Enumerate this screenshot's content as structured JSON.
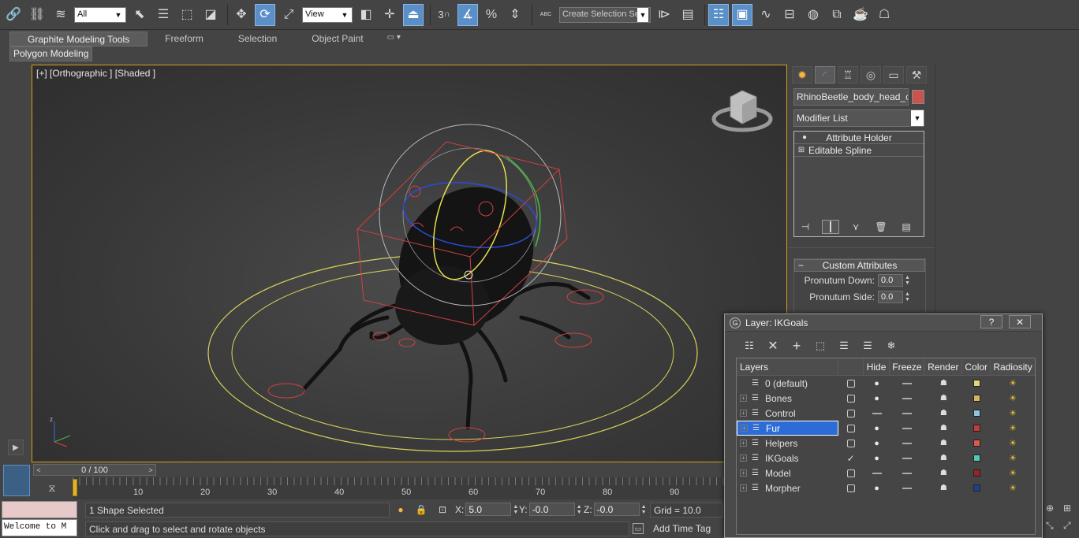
{
  "toolbar": {
    "filter_select": "All",
    "view_select": "View",
    "snap_label": "3",
    "selection_set_placeholder": "Create Selection Se",
    "abc_label": "ABC"
  },
  "ribbon": {
    "tabs": [
      "Graphite Modeling Tools",
      "Freeform",
      "Selection",
      "Object Paint"
    ],
    "panel_label": "Polygon Modeling"
  },
  "viewport": {
    "label": "[+] [Orthographic ] [Shaded ]",
    "axis_label_z": "z"
  },
  "command_panel": {
    "object_name": "RhinoBeetle_body_head_ctrl",
    "object_color": "#c8544d",
    "modifier_list": "Modifier List",
    "stack": [
      "Attribute Holder",
      "Editable Spline"
    ],
    "rollout_title": "Custom Attributes",
    "attributes": [
      {
        "label": "Pronutum Down:",
        "value": "0.0"
      },
      {
        "label": "Pronutum Side:",
        "value": "0.0"
      }
    ]
  },
  "layer_dialog": {
    "title": "Layer: IKGoals",
    "help_btn": "?",
    "close_btn": "✕",
    "columns": [
      "Layers",
      "Hide",
      "Freeze",
      "Render",
      "Color",
      "Radiosity"
    ],
    "rows": [
      {
        "name": "0 (default)",
        "expander": false,
        "active": false,
        "hide_style": "bulb",
        "freeze_style": "dash",
        "color": "#e3d67a",
        "selected": false
      },
      {
        "name": "Bones",
        "expander": true,
        "active": false,
        "hide_style": "bulb",
        "freeze_style": "dash",
        "color": "#d9b45a",
        "selected": false
      },
      {
        "name": "Control",
        "expander": true,
        "active": false,
        "hide_style": "dash",
        "freeze_style": "dash",
        "color": "#8fc4dc",
        "selected": false
      },
      {
        "name": "Fur",
        "expander": true,
        "active": false,
        "hide_style": "bulb",
        "freeze_style": "dash",
        "color": "#c23a3a",
        "selected": true
      },
      {
        "name": "Helpers",
        "expander": true,
        "active": false,
        "hide_style": "bulb",
        "freeze_style": "dash",
        "color": "#d9594f",
        "selected": false
      },
      {
        "name": "IKGoals",
        "expander": true,
        "active": true,
        "hide_style": "bulb",
        "freeze_style": "dash",
        "color": "#4ec9b5",
        "selected": false
      },
      {
        "name": "Model",
        "expander": true,
        "active": false,
        "hide_style": "dash",
        "freeze_style": "dash",
        "color": "#9a2222",
        "selected": false
      },
      {
        "name": "Morpher",
        "expander": true,
        "active": false,
        "hide_style": "bulb",
        "freeze_style": "dash",
        "color": "#1f3f8a",
        "selected": false
      }
    ]
  },
  "timeline": {
    "frame_display": "0 / 100",
    "tick_labels": [
      "10",
      "20",
      "30",
      "40",
      "50",
      "60",
      "70",
      "80",
      "90"
    ],
    "current_frame": 0,
    "total_frames": 100
  },
  "status": {
    "selection_count": "1 Shape Selected",
    "prompt": "Click and drag to select and rotate objects",
    "listener_text": "Welcome to M",
    "x_label": "X:",
    "x_value": "5.0",
    "y_label": "Y:",
    "y_value": "-0.0",
    "z_label": "Z:",
    "z_value": "-0.0",
    "grid": "Grid = 10.0",
    "add_time_tag": "Add Time Tag"
  }
}
